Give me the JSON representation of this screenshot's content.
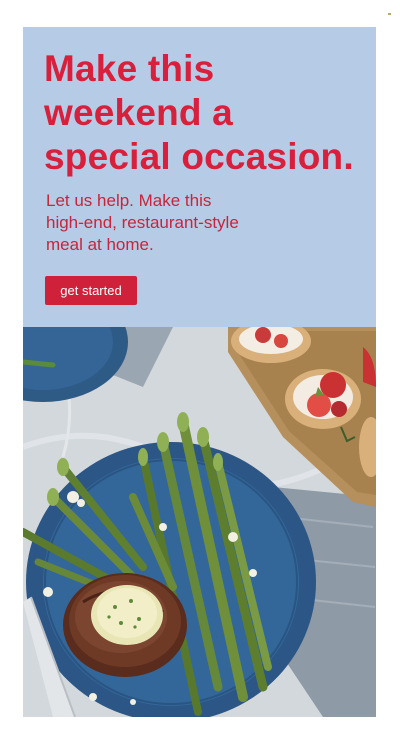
{
  "hero": {
    "headline_lines": [
      "Make this",
      "weekend a",
      "special occasion."
    ],
    "subtext_lines": [
      "Let us help. Make this",
      "high-end, restaurant-style",
      "meal at home."
    ],
    "cta_label": "get started"
  },
  "colors": {
    "panel": "#b6cce6",
    "accent": "#d81f3c",
    "button": "#d0213a",
    "plate": "#2e5a86"
  },
  "photo": {
    "subject": "steak-with-herb-butter-and-asparagus",
    "side": "crostini-with-strawberries-and-ricotta"
  }
}
